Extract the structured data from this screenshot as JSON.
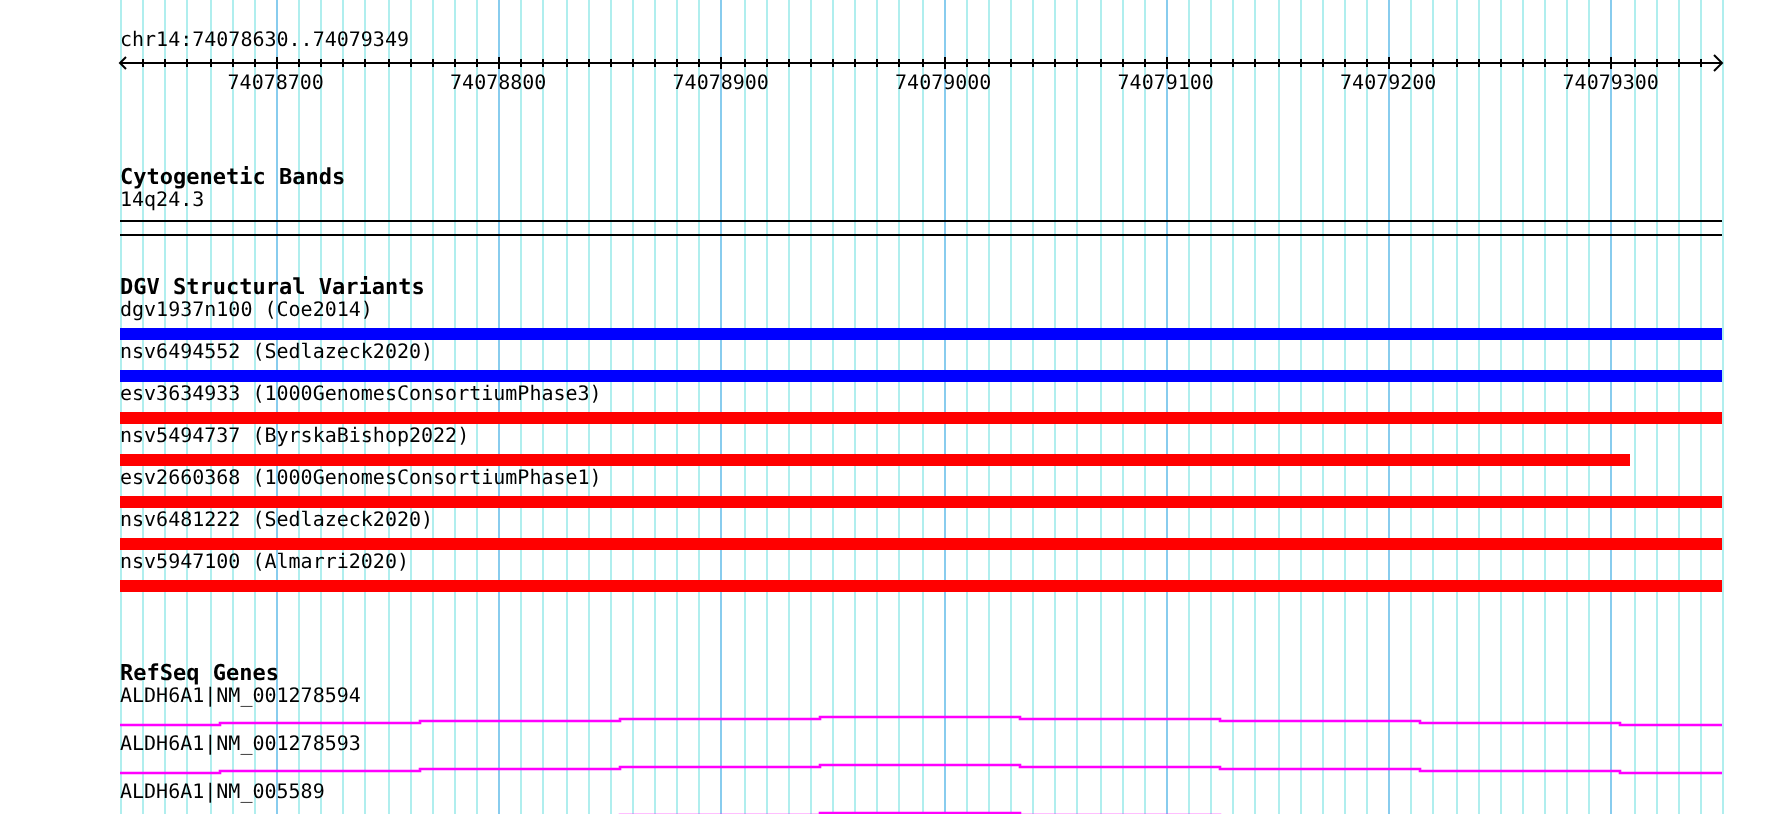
{
  "ruler": {
    "region": "chr14:74078630..74079349",
    "tick_labels": [
      "74078700",
      "74078800",
      "74078900",
      "74079000",
      "74079100",
      "74079200",
      "74079300"
    ]
  },
  "cytogenetic_bands": {
    "title": "Cytogenetic Bands",
    "band": "14q24.3"
  },
  "dgv_structural_variants": {
    "title": "DGV Structural Variants",
    "items": [
      {
        "label": "dgv1937n100 (Coe2014)",
        "color": "#0000ff",
        "level": 1
      },
      {
        "label": "nsv6494552 (Sedlazeck2020)",
        "color": "#0000ff",
        "level": 1
      },
      {
        "label": "esv3634933 (1000GenomesConsortiumPhase3)",
        "color": "#ff0000",
        "level": 1
      },
      {
        "label": "nsv5494737 (ByrskaBishop2022)",
        "color": "#ff0000",
        "level": 0.942
      },
      {
        "label": "esv2660368 (1000GenomesConsortiumPhase1)",
        "color": "#ff0000",
        "level": 1
      },
      {
        "label": "nsv6481222 (Sedlazeck2020)",
        "color": "#ff0000",
        "level": 1
      },
      {
        "label": "nsv5947100 (Almarri2020)",
        "color": "#ff0000",
        "level": 1
      }
    ]
  },
  "refseq_genes": {
    "title": "RefSeq Genes",
    "items": [
      {
        "label": "ALDH6A1|NM_001278594"
      },
      {
        "label": "ALDH6A1|NM_001278593"
      },
      {
        "label": "ALDH6A1|NM_005589"
      }
    ]
  }
}
